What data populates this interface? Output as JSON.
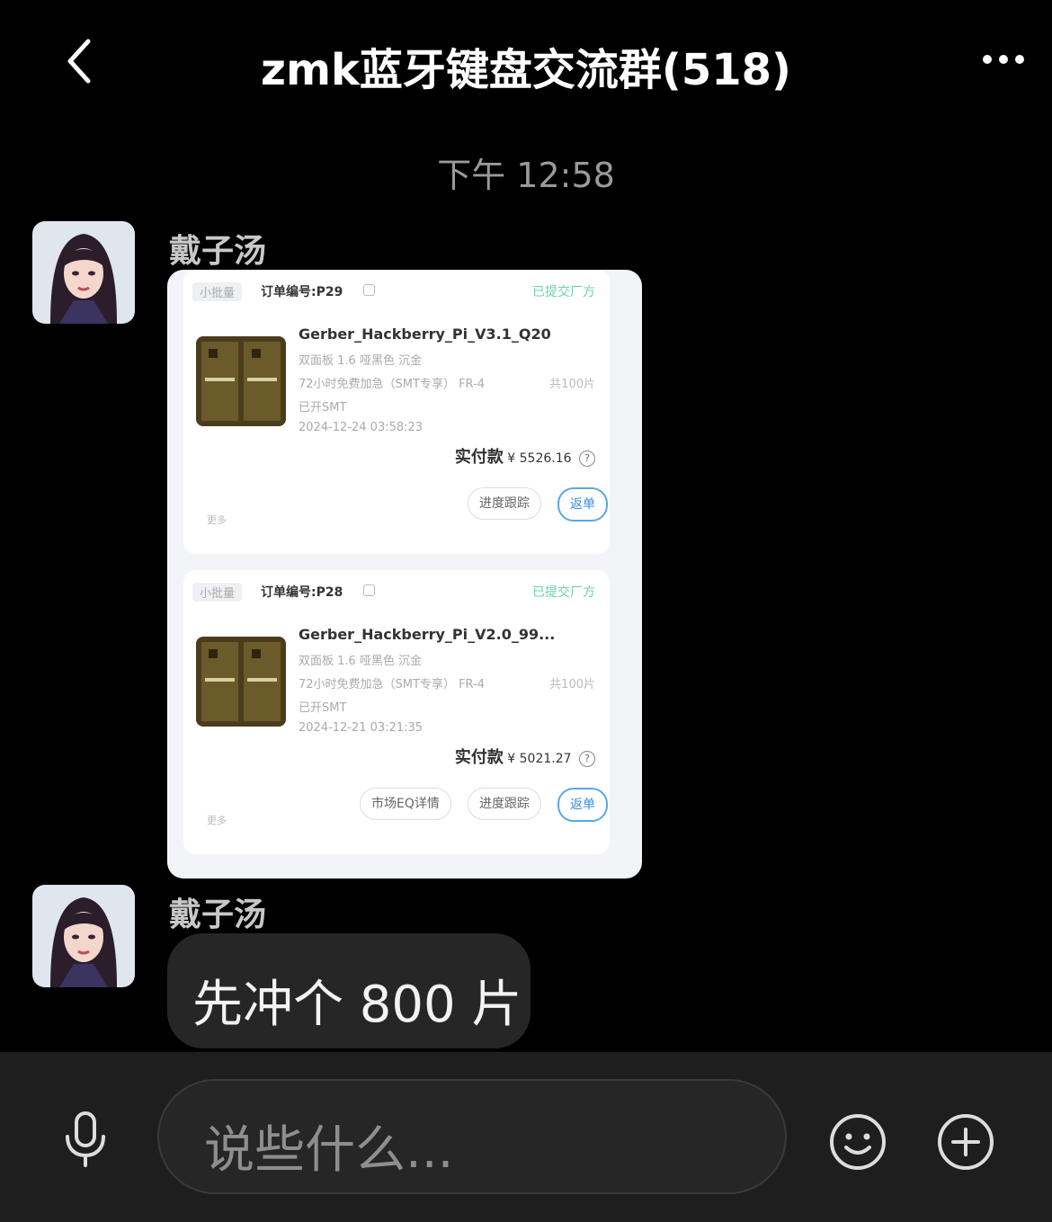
{
  "header": {
    "title": "zmk蓝牙键盘交流群(518)",
    "back_icon": "chevron-left-icon",
    "more_icon": "more-dots-icon"
  },
  "timestamp": "下午 12:58",
  "messages": [
    {
      "sender": "戴子汤",
      "type": "image",
      "orders": [
        {
          "tag": "小批量",
          "order_no": "订单编号:P29",
          "status": "已提交厂方",
          "file": "Gerber_Hackberry_Pi_V3.1_Q20",
          "spec1": "双面板 1.6 哑黑色 沉金",
          "spec2": "72小时免费加急（SMT专享） FR-4",
          "qty": "共100片",
          "smt": "已开SMT",
          "date": "2024-12-24 03:58:23",
          "pay_label": "实付款",
          "pay_value": "¥ 5526.16",
          "buttons": [
            "进度跟踪",
            "返单"
          ],
          "more": "更多"
        },
        {
          "tag": "小批量",
          "order_no": "订单编号:P28",
          "status": "已提交厂方",
          "file": "Gerber_Hackberry_Pi_V2.0_99...",
          "spec1": "双面板 1.6 哑黑色 沉金",
          "spec2": "72小时免费加急（SMT专享） FR-4",
          "qty": "共100片",
          "smt": "已开SMT",
          "date": "2024-12-21 03:21:35",
          "pay_label": "实付款",
          "pay_value": "¥ 5021.27",
          "buttons": [
            "市场EQ详情",
            "进度跟踪",
            "返单"
          ],
          "more": "更多"
        }
      ]
    },
    {
      "sender": "戴子汤",
      "type": "text",
      "text": "先冲个 800 片"
    }
  ],
  "composer": {
    "placeholder": "说些什么...",
    "mic_icon": "microphone-icon",
    "emoji_icon": "smiley-icon",
    "plus_icon": "plus-circle-icon"
  }
}
